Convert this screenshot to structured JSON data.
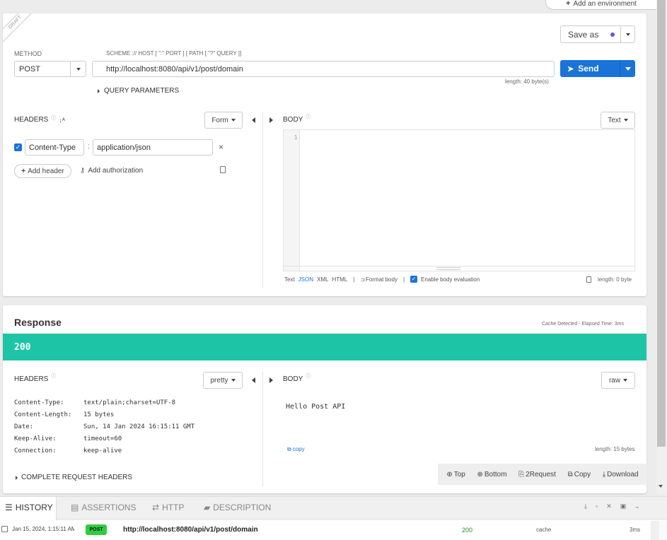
{
  "env_button": "Add an environment",
  "draft_label": "DRAFT",
  "save_as": "Save as",
  "method_label": "METHOD",
  "method_value": "POST",
  "url_hint": "SCHEME :// HOST [ \":\" PORT ] [ PATH [ \"?\" QUERY ]]",
  "url_value": "http://localhost:8080/api/v1/post/domain",
  "url_length": "length: 40 byte(s)",
  "send": "Send",
  "query_params": "QUERY PARAMETERS",
  "headers_title": "HEADERS",
  "form_btn": "Form",
  "header_name": "Content-Type",
  "header_colon": ":",
  "header_value": "application/json",
  "add_header": "Add header",
  "add_auth": "Add authorization",
  "body_title": "BODY",
  "text_btn": "Text",
  "line_number": "1",
  "body_formats": [
    "Text",
    "JSON",
    "XML",
    "HTML"
  ],
  "format_body": "Format body",
  "enable_eval": "Enable body evaluation",
  "body_length": "length: 0 byte",
  "response_title": "Response",
  "cache_info": "Cache Detected - Elapsed Time: 3ms",
  "status_code": "200",
  "resp_headers_title": "HEADERS",
  "pretty_btn": "pretty",
  "resp_body_title": "BODY",
  "raw_btn": "raw",
  "resp_headers": [
    {
      "key": "Content-Type:",
      "value": "text/plain;charset=UTF-8"
    },
    {
      "key": "Content-Length:",
      "value": "15 bytes"
    },
    {
      "key": "Date:",
      "value": "Sun, 14 Jan 2024 16:15:11 GMT"
    },
    {
      "key": "Keep-Alive:",
      "value": "timeout=60"
    },
    {
      "key": "Connection:",
      "value": "keep-alive"
    }
  ],
  "resp_body": "Hello Post API",
  "copy_link": "copy",
  "resp_length": "length: 15 bytes",
  "complete_headers": "COMPLETE REQUEST HEADERS",
  "nav_top": "Top",
  "nav_bottom": "Bottom",
  "nav_2request": "2Request",
  "nav_copy": "Copy",
  "nav_download": "Download",
  "tabs": {
    "history": "HISTORY",
    "assertions": "ASSERTIONS",
    "http": "HTTP",
    "description": "DESCRIPTION"
  },
  "history_row": {
    "date": "Jan 15, 2024, 1:15:11 AM",
    "method": "POST",
    "url": "http://localhost:8080/api/v1/post/domain",
    "status": "200",
    "cache": "cache",
    "time": "3ms"
  },
  "colors": {
    "accent": "#1a73d9",
    "status_green": "#1ec4a6",
    "post_badge": "#2ecc40"
  }
}
